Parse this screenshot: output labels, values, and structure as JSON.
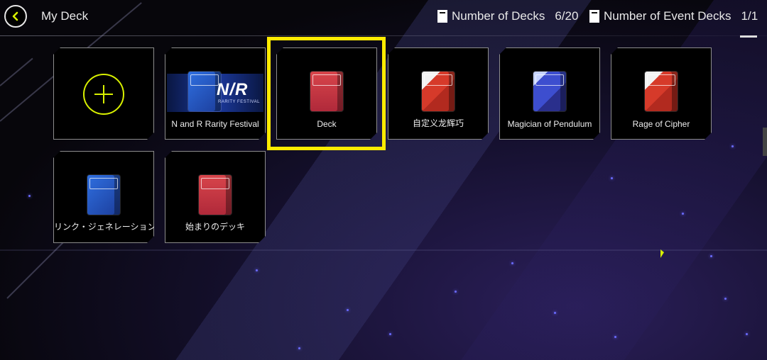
{
  "header": {
    "title": "My Deck",
    "back_icon": "chevron-left-icon",
    "decks_label": "Number of Decks",
    "decks_count": "6/20",
    "event_decks_label": "Number of Event Decks",
    "event_decks_count": "1/1"
  },
  "decks": [
    {
      "name": "N and R Rarity Festival",
      "box": "blue",
      "banner_title": "N/R",
      "banner_sub": "RARITY FESTIVAL"
    },
    {
      "name": "Deck",
      "box": "red",
      "selected": true
    },
    {
      "name": "自定义龙辉巧",
      "box": "art-red"
    },
    {
      "name": "Magician of Pendulum",
      "box": "art-blue"
    },
    {
      "name": "Rage of Cipher",
      "box": "art-red"
    },
    {
      "name": "リンク・ジェネレーション",
      "box": "blue"
    },
    {
      "name": "始まりのデッキ",
      "box": "red"
    }
  ],
  "colors": {
    "accent": "#d8f000",
    "selection": "#ffeb00"
  }
}
